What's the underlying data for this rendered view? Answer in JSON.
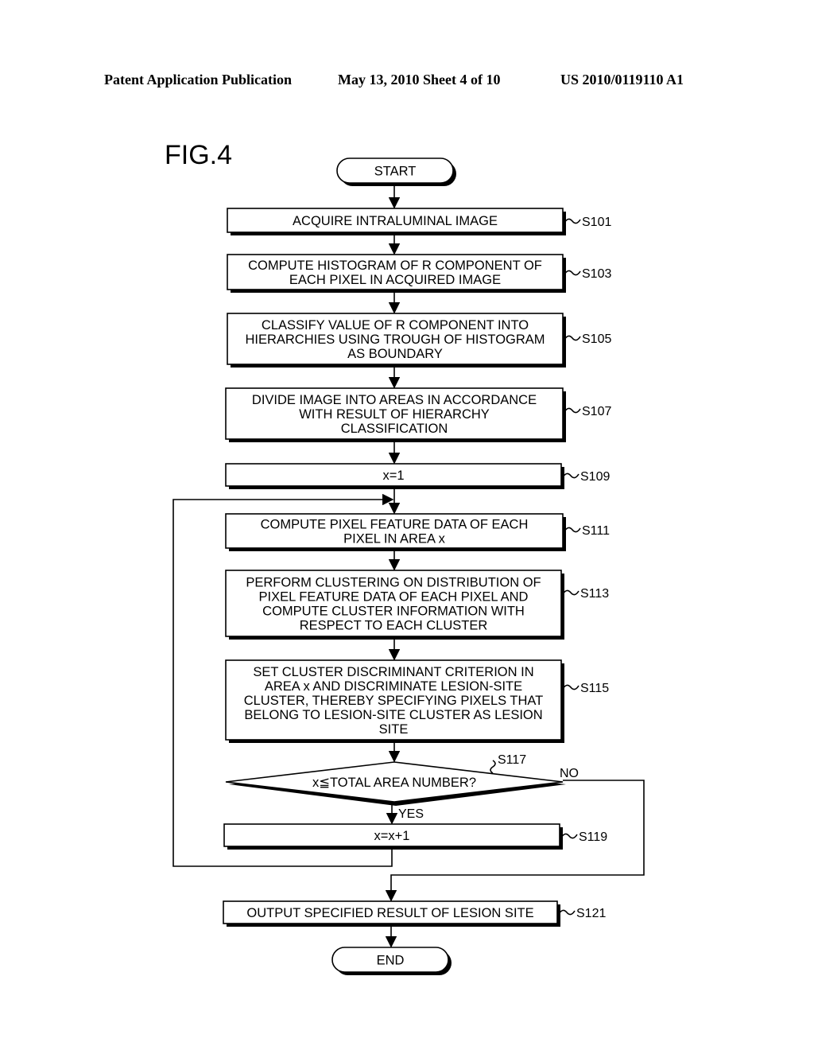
{
  "header": {
    "publication": "Patent Application Publication",
    "date_sheet": "May 13, 2010  Sheet 4 of 10",
    "number": "US 2010/0119110 A1"
  },
  "figure": {
    "label": "FIG.4",
    "start": "START",
    "end": "END",
    "steps": [
      {
        "id": "S101",
        "lines": [
          "ACQUIRE INTRALUMINAL IMAGE"
        ]
      },
      {
        "id": "S103",
        "lines": [
          "COMPUTE HISTOGRAM OF R COMPONENT OF",
          "EACH PIXEL IN ACQUIRED IMAGE"
        ]
      },
      {
        "id": "S105",
        "lines": [
          "CLASSIFY VALUE OF R COMPONENT INTO",
          "HIERARCHIES USING TROUGH OF HISTOGRAM",
          "AS BOUNDARY"
        ]
      },
      {
        "id": "S107",
        "lines": [
          "DIVIDE IMAGE INTO AREAS IN ACCORDANCE",
          "WITH RESULT OF HIERARCHY",
          "CLASSIFICATION"
        ]
      },
      {
        "id": "S109",
        "lines": [
          "x=1"
        ]
      },
      {
        "id": "S111",
        "lines": [
          "COMPUTE PIXEL FEATURE DATA OF EACH",
          "PIXEL IN AREA x"
        ]
      },
      {
        "id": "S113",
        "lines": [
          "PERFORM CLUSTERING ON DISTRIBUTION OF",
          "PIXEL FEATURE DATA OF EACH PIXEL AND",
          "COMPUTE CLUSTER INFORMATION WITH",
          "RESPECT TO EACH CLUSTER"
        ]
      },
      {
        "id": "S115",
        "lines": [
          "SET CLUSTER DISCRIMINANT CRITERION IN",
          "AREA x AND DISCRIMINATE LESION-SITE",
          "CLUSTER, THEREBY SPECIFYING PIXELS THAT",
          "BELONG TO LESION-SITE CLUSTER AS LESION",
          "SITE"
        ]
      },
      {
        "id": "S119",
        "lines": [
          "x=x+1"
        ]
      },
      {
        "id": "S121",
        "lines": [
          "OUTPUT SPECIFIED RESULT OF LESION SITE"
        ]
      }
    ],
    "decision": {
      "id": "S117",
      "text": "x≦TOTAL AREA NUMBER?",
      "yes": "YES",
      "no": "NO"
    }
  }
}
